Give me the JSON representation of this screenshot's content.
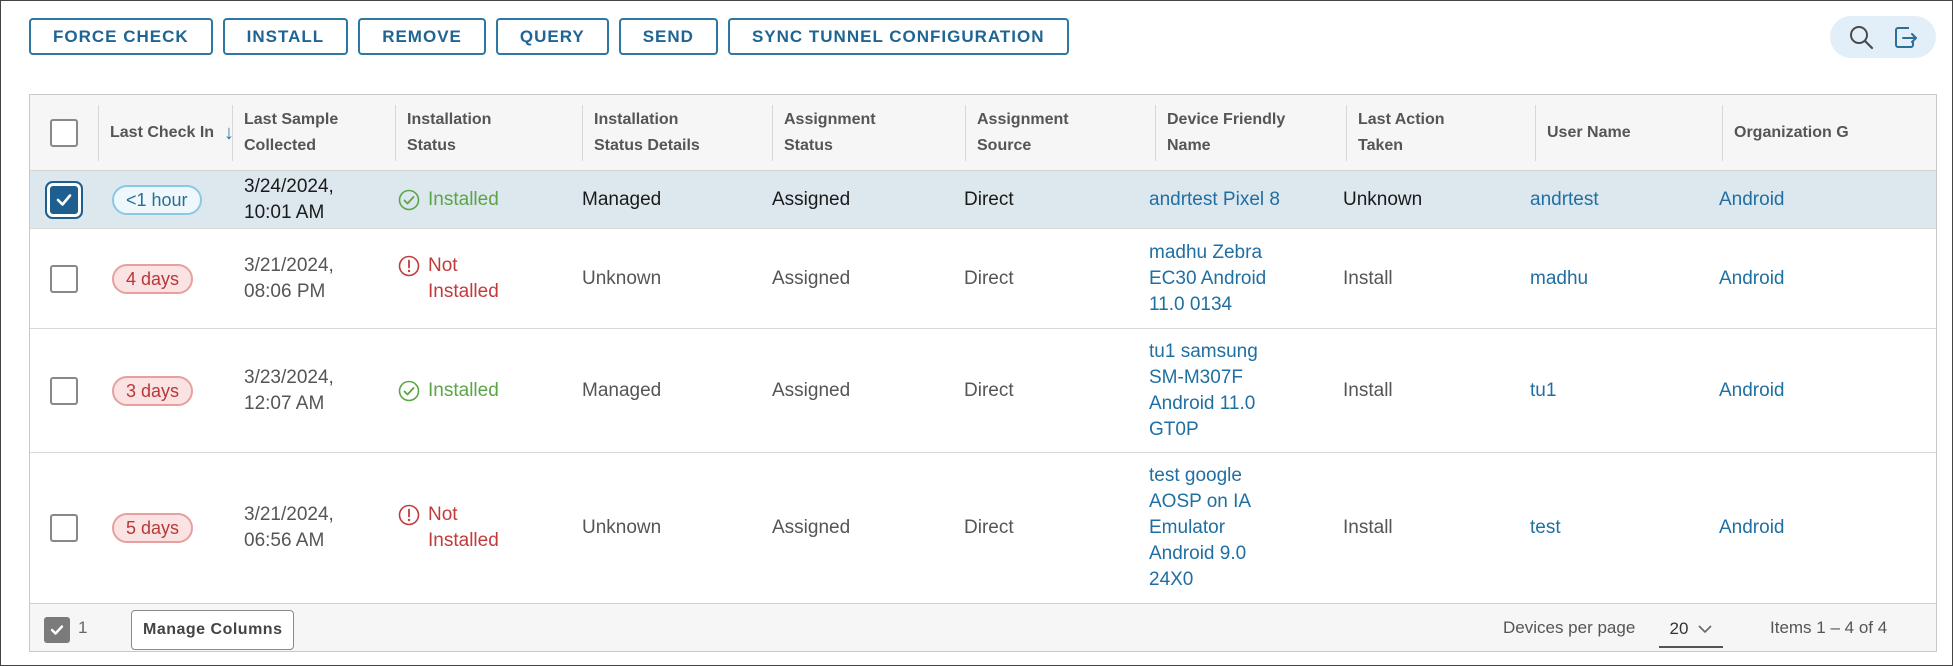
{
  "toolbar": {
    "buttons": [
      "FORCE CHECK",
      "INSTALL",
      "REMOVE",
      "QUERY",
      "SEND",
      "SYNC TUNNEL CONFIGURATION"
    ]
  },
  "icons": {
    "search": "search-icon",
    "export": "export-icon",
    "sort": "arrow-down-icon",
    "status_ok": "check-circle-icon",
    "status_bad": "exclamation-circle-icon"
  },
  "columns": [
    "Last Check In",
    "Last Sample\nCollected",
    "Installation\nStatus",
    "Installation\nStatus Details",
    "Assignment\nStatus",
    "Assignment\nSource",
    "Device Friendly\nName",
    "Last Action\nTaken",
    "User Name",
    "Organization G"
  ],
  "rows": [
    {
      "selected": true,
      "check_in": "<1 hour",
      "sample": "3/24/2024,\n10:01 AM",
      "status": "Installed",
      "status_ok": true,
      "details": "Managed",
      "assignment": "Assigned",
      "source": "Direct",
      "device": "andrtest Pixel 8",
      "action": "Unknown",
      "user": "andrtest",
      "org": "Android"
    },
    {
      "selected": false,
      "check_in": "4 days",
      "sample": "3/21/2024,\n08:06 PM",
      "status": "Not\nInstalled",
      "status_ok": false,
      "details": "Unknown",
      "assignment": "Assigned",
      "source": "Direct",
      "device": "madhu Zebra\nEC30 Android\n11.0 0134",
      "action": "Install",
      "user": "madhu",
      "org": "Android"
    },
    {
      "selected": false,
      "check_in": "3 days",
      "sample": "3/23/2024,\n12:07 AM",
      "status": "Installed",
      "status_ok": true,
      "details": "Managed",
      "assignment": "Assigned",
      "source": "Direct",
      "device": "tu1 samsung\nSM-M307F\nAndroid 11.0\nGT0P",
      "action": "Install",
      "user": "tu1",
      "org": "Android"
    },
    {
      "selected": false,
      "check_in": "5 days",
      "sample": "3/21/2024,\n06:56 AM",
      "status": "Not\nInstalled",
      "status_ok": false,
      "details": "Unknown",
      "assignment": "Assigned",
      "source": "Direct",
      "device": "test google\nAOSP on IA\nEmulator\nAndroid 9.0\n24X0",
      "action": "Install",
      "user": "test",
      "org": "Android"
    }
  ],
  "footer": {
    "selected_count": "1",
    "manage_columns": "Manage Columns",
    "devices_per_page_label": "Devices per page",
    "devices_per_page_value": "20",
    "items_label": "Items 1 – 4 of 4"
  },
  "colors": {
    "accent": "#1f6593",
    "installed": "#5aa545",
    "not_installed": "#c23b3b",
    "selected_row": "#dde7ee"
  }
}
